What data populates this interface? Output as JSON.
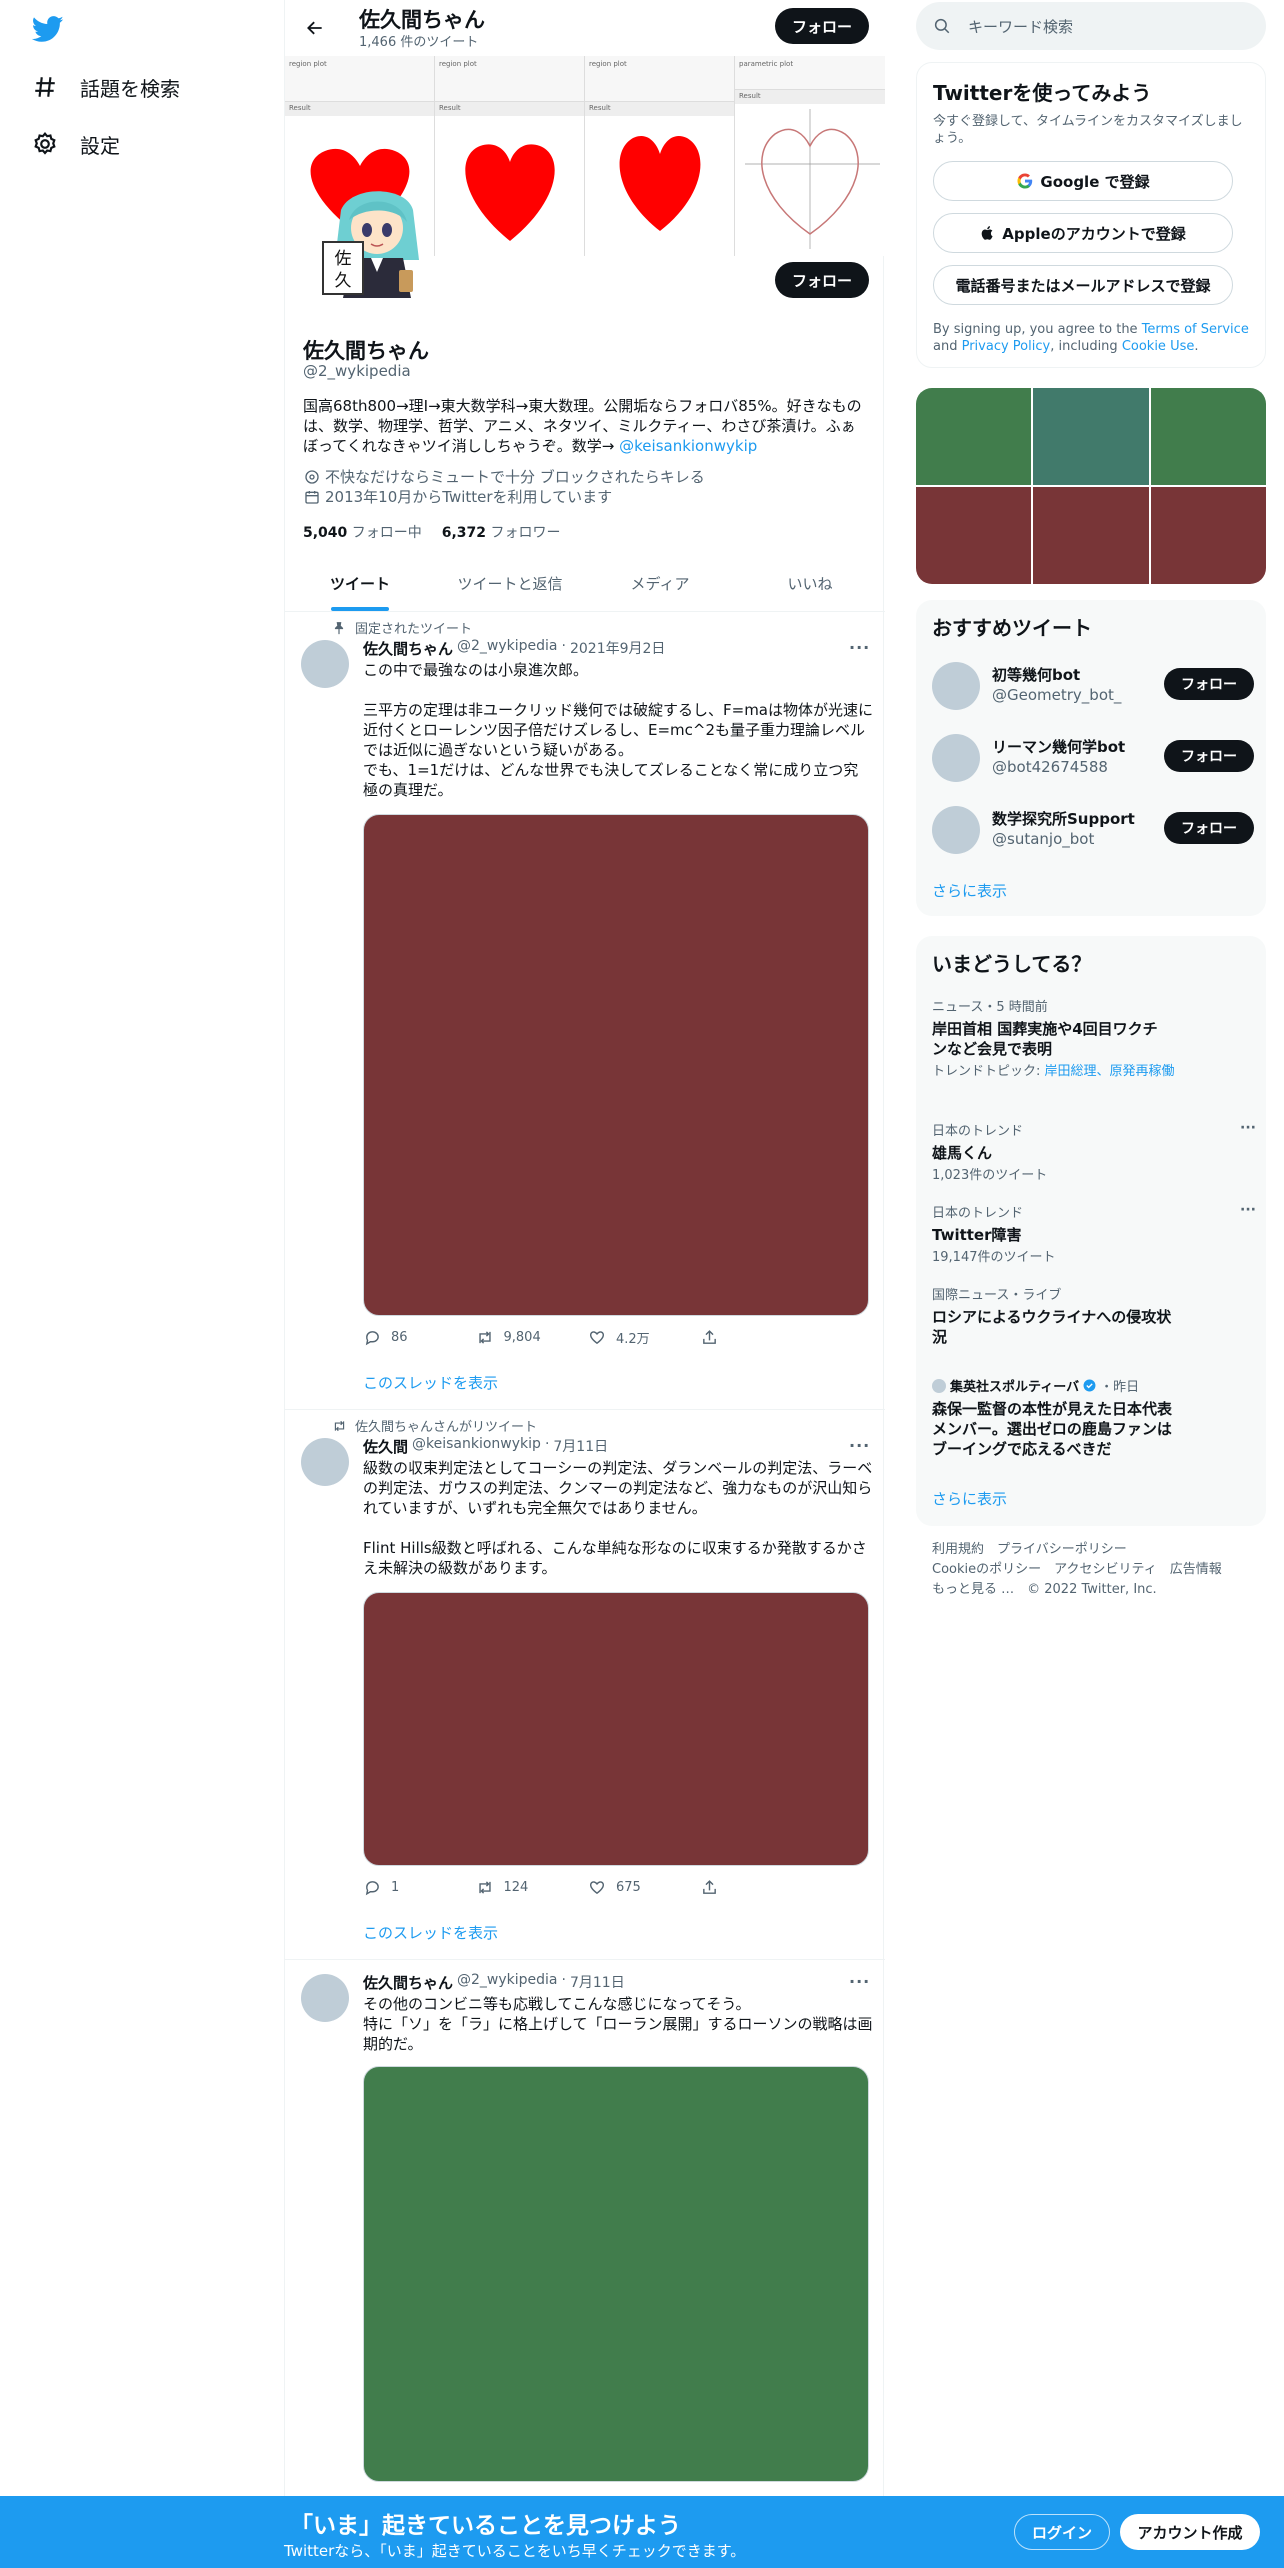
{
  "nav": {
    "explore_label": "話題を検索",
    "settings_label": "設定"
  },
  "topbar": {
    "name": "佐久間ちゃん",
    "tweet_count": "1,466 件のツイート",
    "follow_label": "フォロー"
  },
  "banner": {
    "plots": [
      {
        "header": "region plot",
        "result": "Result"
      },
      {
        "header": "region plot",
        "result": "Result"
      },
      {
        "header": "region plot",
        "result": "Result"
      },
      {
        "header": "parametric plot",
        "result": "Result"
      }
    ]
  },
  "avatar_text": "佐久",
  "profile": {
    "follow_label": "フォロー",
    "name": "佐久間ちゃん",
    "handle": "@2_wykipedia",
    "bio": "国高68th800→理I→東大数学科→東大数理。公開垢ならフォロバ85%。好きなものは、数学、物理学、哲学、アニメ、ネタツイ、ミルクティー、わさび茶漬け。ふぁぼってくれなきゃツイ消ししちゃうぞ。数学→ ",
    "bio_link": "@keisankionwykip",
    "location": "不快なだけならミュートで十分 ブロックされたらキレる",
    "joined": "2013年10月からTwitterを利用しています",
    "following_count": "5,040",
    "following_label": "フォロー中",
    "followers_count": "6,372",
    "followers_label": "フォロワー"
  },
  "tabs": [
    "ツイート",
    "ツイートと返信",
    "メディア",
    "いいね"
  ],
  "tweets": [
    {
      "context": "固定されたツイート",
      "name": "佐久間ちゃん",
      "handle": "@2_wykipedia",
      "date": "2021年9月2日",
      "text": "この中で最強なのは小泉進次郎。\n\n三平方の定理は非ユークリッド幾何では破綻するし、F=maは物体が光速に近付くとローレンツ因子倍だけズレるし、E=mc^2も量子重力理論レベルでは近似に過ぎないという疑いがある。\nでも、1=1だけは、どんな世界でも決してズレることなく常に成り立つ究極の真理だ。",
      "media_color": "#783537",
      "replies": "86",
      "retweets": "9,804",
      "likes": "4.2万",
      "show_thread": "このスレッドを表示"
    },
    {
      "context": "佐久間ちゃんさんがリツイート",
      "name": "佐久間",
      "handle": "@keisankionwykip",
      "date": "7月11日",
      "text": "級数の収束判定法としてコーシーの判定法、ダランベールの判定法、ラーベの判定法、ガウスの判定法、クンマーの判定法など、強力なものが沢山知られていますが、いずれも完全無欠ではありません。\n\nFlint Hills級数と呼ばれる、こんな単純な形なのに収束するか発散するかさえ未解決の級数があります。",
      "media_color": "#783537",
      "replies": "1",
      "retweets": "124",
      "likes": "675",
      "show_thread": "このスレッドを表示"
    },
    {
      "name": "佐久間ちゃん",
      "handle": "@2_wykipedia",
      "date": "7月11日",
      "text": "その他のコンビニ等も応戦してこんな感じになってそう。\n特に「ソ」を「ラ」に格上げして「ローラン展開」するローソンの戦略は画期的だ。",
      "media_color": "#417d4c"
    }
  ],
  "search": {
    "placeholder": "キーワード検索"
  },
  "signup": {
    "title": "Twitterを使ってみよう",
    "subtitle": "今すぐ登録して、タイムラインをカスタマイズしましょう。",
    "google": "Google で登録",
    "apple": "Appleのアカウントで登録",
    "phone": "電話番号またはメールアドレスで登録",
    "terms_prefix": "By signing up, you agree to the ",
    "terms_link": "Terms of Service",
    "terms_and": " and ",
    "privacy_link": "Privacy Policy",
    "terms_including": ", including ",
    "cookie_link": "Cookie Use",
    "terms_end": "."
  },
  "photos": [
    "#417d4c",
    "#417a6b",
    "#417d4c",
    "#783537",
    "#783537",
    "#783537"
  ],
  "recommend": {
    "title": "おすすめツイート",
    "users": [
      {
        "name": "初等幾何bot",
        "handle": "@Geometry_bot_"
      },
      {
        "name": "リーマン幾何学bot",
        "handle": "@bot42674588"
      },
      {
        "name": "数学探究所Support",
        "handle": "@sutanjo_bot"
      }
    ],
    "follow_label": "フォロー",
    "more": "さらに表示"
  },
  "trends": {
    "title": "いまどうしてる？",
    "items": [
      {
        "meta": "ニュース・5 時間前",
        "title": "岸田首相 国葬実施や4回目ワクチンなど会見で表明",
        "sub_prefix": "トレンドトピック: ",
        "sub_links": "岸田総理、原発再稼働"
      },
      {
        "meta": "日本のトレンド",
        "title": "雄馬くん",
        "sub": "1,023件のツイート"
      },
      {
        "meta": "日本のトレンド",
        "title": "Twitter障害",
        "sub": "19,147件のツイート"
      },
      {
        "meta": "国際ニュース・ライブ",
        "title": "ロシアによるウクライナへの侵攻状況"
      },
      {
        "meta_name": "集英社スポルティーバ",
        "meta_time": "・昨日",
        "title": "森保一監督の本性が見えた日本代表メンバー。選出ゼロの鹿島ファンはブーイングで応えるべきだ"
      }
    ],
    "more": "さらに表示"
  },
  "footer": {
    "line1": "利用規約　プライバシーポリシー",
    "line2": "Cookieのポリシー　アクセシビリティ　広告情報",
    "line3": "もっと見る …　© 2022 Twitter, Inc."
  },
  "bottom": {
    "headline": "「いま」起きていることを見つけよう",
    "sub": "Twitterなら、「いま」起きていることをいち早くチェックできます。",
    "login": "ログイン",
    "signup": "アカウント作成"
  }
}
